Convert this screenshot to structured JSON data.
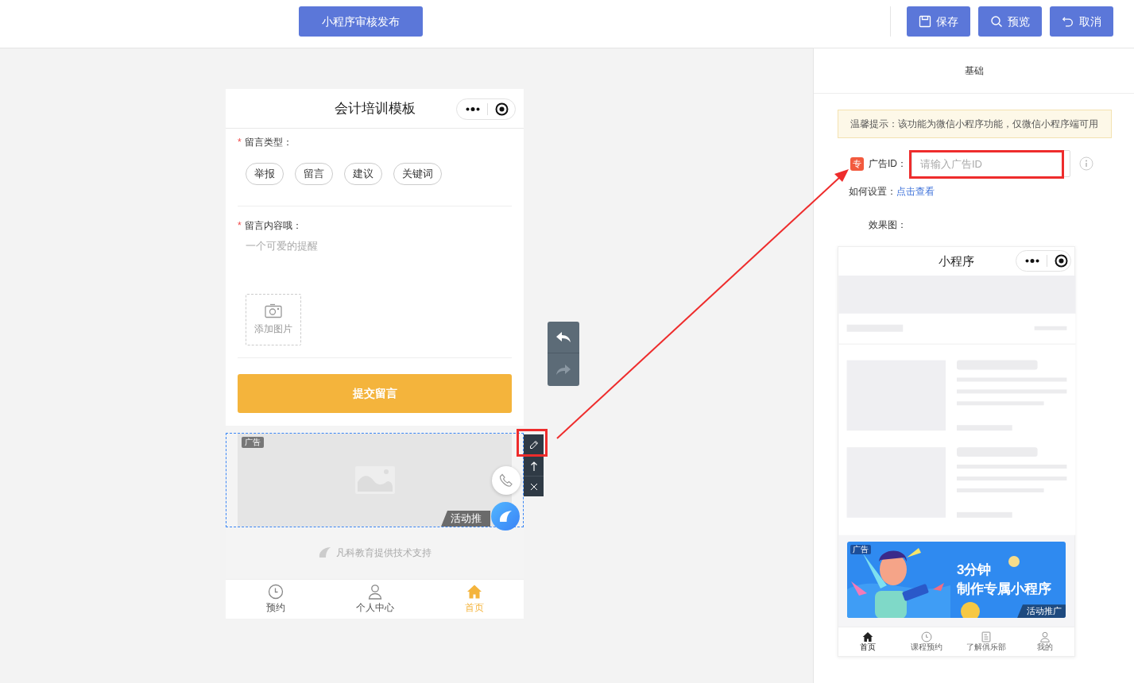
{
  "top_bar": {
    "publish_button": "小程序审核发布",
    "actions": [
      {
        "kind": "save",
        "label": "保存"
      },
      {
        "kind": "preview",
        "label": "预览"
      },
      {
        "kind": "cancel",
        "label": "取消"
      }
    ]
  },
  "phone": {
    "title": "会计培训模板",
    "form": {
      "required_mark": "*",
      "type_label": "留言类型：",
      "types": [
        "举报",
        "留言",
        "建议",
        "关键词"
      ],
      "content_label": "留言内容哦：",
      "content_placeholder": "一个可爱的提醒",
      "upload_label": "添加图片",
      "submit": "提交留言"
    },
    "ad": {
      "tag": "广告",
      "link": "活动推"
    },
    "support": "凡科教育提供技术支持",
    "tabs": [
      {
        "kind": "clock",
        "label": "预约",
        "selected": false
      },
      {
        "kind": "person",
        "label": "个人中心",
        "selected": false
      },
      {
        "kind": "home",
        "label": "首页",
        "selected": true
      }
    ]
  },
  "settings": {
    "tab": "基础",
    "notice": "温馨提示：该功能为微信小程序功能，仅微信小程序端可用",
    "badge": "专",
    "ad_id": {
      "label": "广告ID：",
      "placeholder": "请输入广告ID"
    },
    "howto": {
      "label": "如何设置：",
      "link": "点击查看"
    },
    "effect_label": "效果图：",
    "preview": {
      "title": "小程序",
      "banner": {
        "tag": "广告",
        "headline": [
          "3分钟",
          "制作专属小程序"
        ],
        "link": "活动推广"
      },
      "tabs": [
        {
          "kind": "home",
          "label": "首页",
          "selected": true
        },
        {
          "kind": "clock",
          "label": "课程预约",
          "selected": false
        },
        {
          "kind": "doc",
          "label": "了解俱乐部",
          "selected": false
        },
        {
          "kind": "person",
          "label": "我的",
          "selected": false
        }
      ]
    }
  }
}
